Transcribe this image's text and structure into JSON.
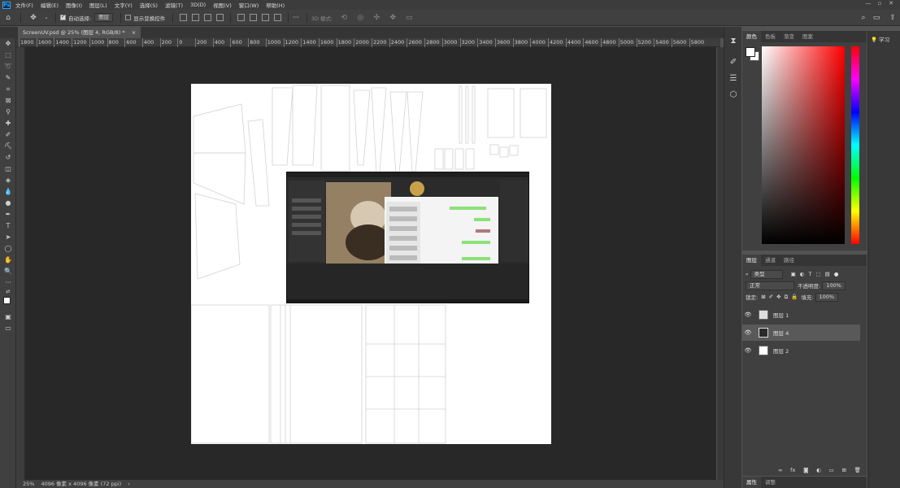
{
  "app": {
    "logo": "Ps",
    "menu": [
      "文件(F)",
      "编辑(E)",
      "图像(I)",
      "图层(L)",
      "文字(Y)",
      "选择(S)",
      "滤镜(T)",
      "3D(D)",
      "视图(V)",
      "窗口(W)",
      "帮助(H)"
    ],
    "window_controls": [
      "—",
      "▫",
      "✕"
    ]
  },
  "options": {
    "auto_select_label": "自动选择:",
    "auto_select_target": "图层",
    "show_transform_label": "显示变换控件",
    "mode_3d_label": "3D 模式:",
    "more_label": "···"
  },
  "document": {
    "tab_title": "ScreenUV.psd @ 25% (图层 4, RGB/8) *",
    "tab_close": "×",
    "zoom": "25%",
    "size_info": "4096 像素 x 4096 像素 (72 ppi)",
    "status_arrow": "›"
  },
  "ruler": {
    "ticks": [
      "1800",
      "1600",
      "1400",
      "1200",
      "1000",
      "800",
      "600",
      "400",
      "200",
      "0",
      "200",
      "400",
      "600",
      "800",
      "1000",
      "1200",
      "1400",
      "1600",
      "1800",
      "2000",
      "2200",
      "2400",
      "2600",
      "2800",
      "3000",
      "3200",
      "3400",
      "3600",
      "3800",
      "4000",
      "4200",
      "4400",
      "4600",
      "4800",
      "5000",
      "5200",
      "5400",
      "5600",
      "5800"
    ]
  },
  "color_panel": {
    "tabs": [
      "颜色",
      "色板",
      "渐变",
      "图案"
    ],
    "active_tab": 0,
    "fg_color": "#ffffff",
    "bg_color": "#ffffff"
  },
  "layers_panel": {
    "tabs": [
      "图层",
      "通道",
      "路径"
    ],
    "filter_label": "类型",
    "blend_mode": "正常",
    "opacity_label": "不透明度:",
    "opacity_value": "100%",
    "lock_label": "锁定:",
    "fill_label": "填充:",
    "fill_value": "100%",
    "layers": [
      {
        "name": "图层 1",
        "selected": false
      },
      {
        "name": "图层 4",
        "selected": true
      },
      {
        "name": "图层 2",
        "selected": false
      }
    ],
    "footer_icons": [
      "link-icon",
      "fx-icon",
      "mask-icon",
      "adjustment-icon",
      "folder-icon",
      "new-layer-icon",
      "trash-icon"
    ]
  },
  "properties_tabs": [
    "属性",
    "调整"
  ],
  "learn_panel": {
    "label": "学习"
  },
  "colors": {
    "accent": "#31a8ff",
    "panel": "#404040",
    "workspace": "#282828"
  }
}
